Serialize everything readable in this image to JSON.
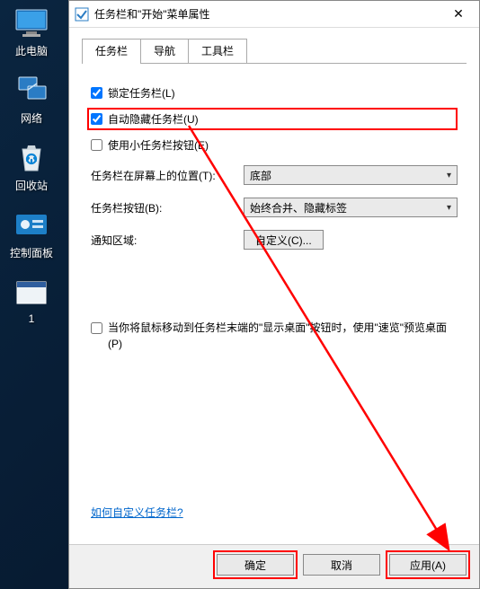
{
  "desktop": {
    "items": [
      {
        "label": "此电脑"
      },
      {
        "label": "网络"
      },
      {
        "label": "回收站"
      },
      {
        "label": "控制面板"
      },
      {
        "label": "1"
      }
    ]
  },
  "dialog": {
    "title": "任务栏和\"开始\"菜单属性",
    "tabs": [
      {
        "label": "任务栏"
      },
      {
        "label": "导航"
      },
      {
        "label": "工具栏"
      }
    ],
    "checkboxes": {
      "lock": {
        "label": "锁定任务栏(L)",
        "checked": true
      },
      "hide": {
        "label": "自动隐藏任务栏(U)",
        "checked": true
      },
      "small": {
        "label": "使用小任务栏按钮(E)",
        "checked": false
      }
    },
    "position": {
      "label": "任务栏在屏幕上的位置(T):",
      "value": "底部"
    },
    "buttonsMode": {
      "label": "任务栏按钮(B):",
      "value": "始终合并、隐藏标签"
    },
    "notifyArea": {
      "label": "通知区域:",
      "button": "自定义(C)..."
    },
    "peek": {
      "label": "当你将鼠标移动到任务栏末端的\"显示桌面\"按钮时，使用\"速览\"预览桌面(P)",
      "checked": false
    },
    "helpLink": "如何自定义任务栏?",
    "buttons": {
      "ok": "确定",
      "cancel": "取消",
      "apply": "应用(A)"
    }
  }
}
